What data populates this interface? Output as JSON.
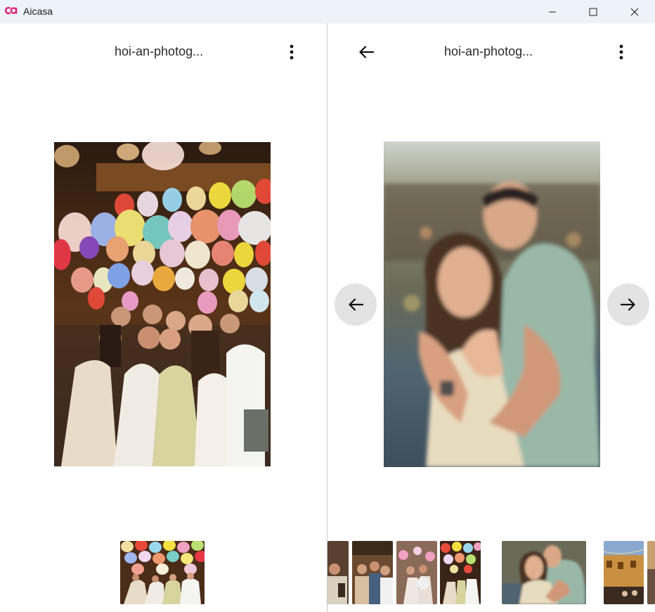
{
  "window": {
    "app_name": "Aicasa",
    "accent_color": "#e0247a",
    "controls": [
      "minimize-icon",
      "maximize-icon",
      "close-icon"
    ]
  },
  "left_pane": {
    "title": "hoi-an-photog...",
    "menu_icon": "kebab-menu-icon",
    "photo": {
      "subject": "group-lanterns-photo"
    },
    "filmstrip": [
      {
        "subject": "group-lanterns-thumb"
      }
    ]
  },
  "right_pane": {
    "back_icon": "arrow-left-icon",
    "title": "hoi-an-photog...",
    "menu_icon": "kebab-menu-icon",
    "photo": {
      "subject": "couple-engagement-photo"
    },
    "prev_icon": "arrow-left-icon",
    "next_icon": "arrow-right-icon",
    "filmstrip": [
      {
        "subject": "group-partial-thumb"
      },
      {
        "subject": "friends-bar-thumb"
      },
      {
        "subject": "party-lanterns-thumb"
      },
      {
        "subject": "lanterns-group-thumb"
      },
      {
        "subject": "couple-thumb",
        "selected": true
      },
      {
        "subject": "street-lanterns-thumb"
      },
      {
        "subject": "street-partial-thumb"
      }
    ]
  }
}
